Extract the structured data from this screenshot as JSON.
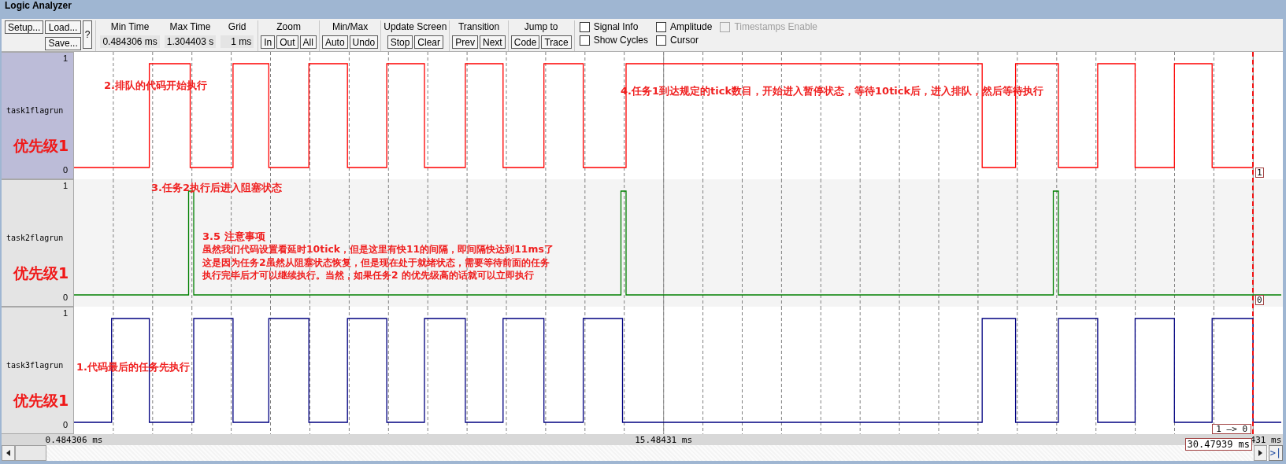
{
  "window": {
    "title": "Logic Analyzer"
  },
  "toolbar": {
    "file_buttons": [
      "Setup...",
      "Load...",
      "Save..."
    ],
    "help_button": "?",
    "fields": [
      {
        "label": "Min Time",
        "value": "0.484306 ms"
      },
      {
        "label": "Max Time",
        "value": "1.304403 s"
      },
      {
        "label": "Grid",
        "value": "1 ms"
      }
    ],
    "groups": [
      {
        "title": "Zoom",
        "buttons": [
          "In",
          "Out",
          "All"
        ]
      },
      {
        "title": "Min/Max",
        "buttons": [
          "Auto",
          "Undo"
        ]
      },
      {
        "title": "Update Screen",
        "buttons": [
          "Stop",
          "Clear"
        ]
      },
      {
        "title": "Transition",
        "buttons": [
          "Prev",
          "Next"
        ]
      },
      {
        "title": "Jump to",
        "buttons": [
          "Code",
          "Trace"
        ]
      }
    ],
    "options": [
      {
        "label": "Signal Info",
        "checked": false,
        "disabled": false
      },
      {
        "label": "Amplitude",
        "checked": false,
        "disabled": false
      },
      {
        "label": "Timestamps Enable",
        "checked": false,
        "disabled": true
      },
      {
        "label": "Show Cycles",
        "checked": false,
        "disabled": false
      },
      {
        "label": "Cursor",
        "checked": false,
        "disabled": false
      }
    ]
  },
  "signals": [
    {
      "name": "task1flagrun",
      "color": "#ff0000",
      "selected": true,
      "note": "优先级1",
      "level_labels": [
        "1",
        "0"
      ],
      "cursor_value": {
        "kind": "level",
        "text": "1"
      }
    },
    {
      "name": "task2flagrun",
      "color": "#008000",
      "selected": false,
      "note": "优先级1",
      "level_labels": [
        "1",
        "0"
      ],
      "cursor_value": {
        "kind": "level",
        "text": "0"
      }
    },
    {
      "name": "task3flagrun",
      "color": "#000080",
      "selected": false,
      "note": "优先级1",
      "level_labels": [
        "1",
        "0"
      ],
      "cursor_value": {
        "kind": "transition",
        "text": "1 —> 0"
      }
    }
  ],
  "annotations": [
    {
      "text": "2.排队的代码开始执行"
    },
    {
      "text": "3.任务2执行后进入阻塞状态"
    },
    {
      "text": "3.5 注意事项"
    },
    {
      "text": "虽然我们代码设置看延时10tick，但是这里有快11的间隔，即间隔快达到11ms了这是因为任务2虽然从阻塞状态恢复，但是现在处于就绪状态，需要等待前面的任务执行完毕后才可以继续执行。当然，如果任务2 的优先级高的话就可以立即执行"
    },
    {
      "text": "4.任务1到达规定的tick数目，开始进入暂停状态，等待10tick后，进入排队，然后等待执行"
    },
    {
      "text": "1.代码最后的任务先执行"
    }
  ],
  "time_axis": {
    "labels": [
      {
        "label": "0.484306 ms",
        "kind": "full"
      },
      {
        "label": "15.48431 ms",
        "kind": "full"
      },
      {
        "label": "431 ms",
        "kind": "partial"
      }
    ]
  },
  "cursor": {
    "time_label": "30.47939 ms"
  },
  "scrollbar": {
    "end_button": ">|"
  }
}
